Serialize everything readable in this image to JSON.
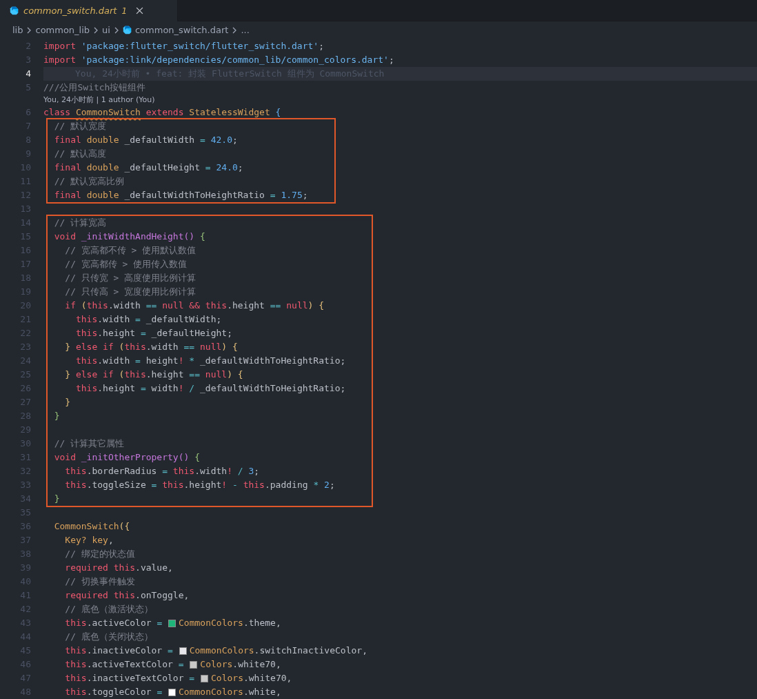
{
  "tabs": [
    {
      "label": "common_switch.dart",
      "problems": "1",
      "selected": true
    }
  ],
  "breadcrumbs": [
    {
      "label": "lib",
      "kind": "folder"
    },
    {
      "label": "common_lib",
      "kind": "folder"
    },
    {
      "label": "ui",
      "kind": "folder"
    },
    {
      "label": "common_switch.dart",
      "kind": "file"
    },
    {
      "label": "...",
      "kind": "more"
    }
  ],
  "blocks": [
    {
      "boxed": false,
      "lines": [
        {
          "number": "2",
          "current": false,
          "tokens": [
            {
              "kind": "kw",
              "text": "import "
            },
            {
              "kind": "str",
              "text": "'package:flutter_switch/flutter_switch.dart'"
            },
            {
              "kind": "plain",
              "text": ";"
            }
          ]
        },
        {
          "number": "3",
          "current": false,
          "tokens": [
            {
              "kind": "kw",
              "text": "import "
            },
            {
              "kind": "str",
              "text": "'package:link/dependencies/common_lib/common_colors.dart'"
            },
            {
              "kind": "plain",
              "text": ";"
            }
          ]
        },
        {
          "number": "4",
          "current": true,
          "blame": "You, 24小时前 • feat: 封装 FlutterSwitch 组件为 CommonSwitch"
        },
        {
          "number": "5",
          "current": false,
          "codelens": "You, 24小时前 | 1 author (You)",
          "tokens": [
            {
              "kind": "com",
              "text": "///公用Switch按钮组件"
            }
          ]
        },
        {
          "number": "6",
          "current": false,
          "tokens": [
            {
              "kind": "kw",
              "text": "class "
            },
            {
              "kind": "type",
              "text": "CommonSwitch",
              "warning": true
            },
            {
              "kind": "kw",
              "text": " extends "
            },
            {
              "kind": "type",
              "text": "StatelessWidget "
            },
            {
              "kind": "brace3",
              "text": "{"
            }
          ]
        }
      ]
    },
    {
      "boxed": true,
      "lines": [
        {
          "number": "7",
          "current": false,
          "tokens": [
            {
              "kind": "com",
              "text": "  // 默认宽度"
            }
          ]
        },
        {
          "number": "8",
          "current": false,
          "tokens": [
            {
              "kind": "kw",
              "text": "  final "
            },
            {
              "kind": "type",
              "text": "double "
            },
            {
              "kind": "plain",
              "text": "_defaultWidth "
            },
            {
              "kind": "op",
              "text": "= "
            },
            {
              "kind": "num",
              "text": "42.0"
            },
            {
              "kind": "plain",
              "text": ";"
            }
          ]
        },
        {
          "number": "9",
          "current": false,
          "tokens": [
            {
              "kind": "com",
              "text": "  // 默认高度"
            }
          ]
        },
        {
          "number": "10",
          "current": false,
          "tokens": [
            {
              "kind": "kw",
              "text": "  final "
            },
            {
              "kind": "type",
              "text": "double "
            },
            {
              "kind": "plain",
              "text": "_defaultHeight "
            },
            {
              "kind": "op",
              "text": "= "
            },
            {
              "kind": "num",
              "text": "24.0"
            },
            {
              "kind": "plain",
              "text": ";"
            }
          ]
        },
        {
          "number": "11",
          "current": false,
          "tokens": [
            {
              "kind": "com",
              "text": "  // 默认宽高比例"
            }
          ]
        },
        {
          "number": "12",
          "current": false,
          "tokens": [
            {
              "kind": "kw",
              "text": "  final "
            },
            {
              "kind": "type",
              "text": "double "
            },
            {
              "kind": "plain",
              "text": "_defaultWidthToHeightRatio "
            },
            {
              "kind": "op",
              "text": "= "
            },
            {
              "kind": "num",
              "text": "1.75"
            },
            {
              "kind": "plain",
              "text": ";"
            }
          ]
        }
      ]
    },
    {
      "boxed": false,
      "lines": [
        {
          "number": "13",
          "current": false
        }
      ]
    },
    {
      "boxed": true,
      "lines": [
        {
          "number": "14",
          "current": false,
          "tokens": [
            {
              "kind": "com",
              "text": "  // 计算宽高"
            }
          ]
        },
        {
          "number": "15",
          "current": false,
          "tokens": [
            {
              "kind": "kw",
              "text": "  void "
            },
            {
              "kind": "fn",
              "text": "_initWidthAndHeight"
            },
            {
              "kind": "brace2",
              "text": "() "
            },
            {
              "kind": "brace4",
              "text": "{"
            }
          ]
        },
        {
          "number": "16",
          "current": false,
          "tokens": [
            {
              "kind": "com",
              "text": "    // 宽高都不传 > 使用默认数值"
            }
          ]
        },
        {
          "number": "17",
          "current": false,
          "tokens": [
            {
              "kind": "com",
              "text": "    // 宽高都传 > 使用传入数值"
            }
          ]
        },
        {
          "number": "18",
          "current": false,
          "tokens": [
            {
              "kind": "com",
              "text": "    // 只传宽 > 高度使用比例计算"
            }
          ]
        },
        {
          "number": "19",
          "current": false,
          "tokens": [
            {
              "kind": "com",
              "text": "    // 只传高 > 宽度使用比例计算"
            }
          ]
        },
        {
          "number": "20",
          "current": false,
          "tokens": [
            {
              "kind": "kw",
              "text": "    if "
            },
            {
              "kind": "brace1",
              "text": "("
            },
            {
              "kind": "kw",
              "text": "this"
            },
            {
              "kind": "plain",
              "text": ".width "
            },
            {
              "kind": "op",
              "text": "== "
            },
            {
              "kind": "kw",
              "text": "null && this"
            },
            {
              "kind": "plain",
              "text": ".height "
            },
            {
              "kind": "op",
              "text": "== "
            },
            {
              "kind": "kw",
              "text": "null"
            },
            {
              "kind": "brace1",
              "text": ") {"
            }
          ]
        },
        {
          "number": "21",
          "current": false,
          "tokens": [
            {
              "kind": "kw",
              "text": "      this"
            },
            {
              "kind": "plain",
              "text": ".width "
            },
            {
              "kind": "op",
              "text": "="
            },
            {
              "kind": "plain",
              "text": " _defaultWidth;"
            }
          ]
        },
        {
          "number": "22",
          "current": false,
          "tokens": [
            {
              "kind": "kw",
              "text": "      this"
            },
            {
              "kind": "plain",
              "text": ".height "
            },
            {
              "kind": "op",
              "text": "="
            },
            {
              "kind": "plain",
              "text": " _defaultHeight;"
            }
          ]
        },
        {
          "number": "23",
          "current": false,
          "tokens": [
            {
              "kind": "brace1",
              "text": "    } "
            },
            {
              "kind": "kw",
              "text": "else if "
            },
            {
              "kind": "brace1",
              "text": "("
            },
            {
              "kind": "kw",
              "text": "this"
            },
            {
              "kind": "plain",
              "text": ".width "
            },
            {
              "kind": "op",
              "text": "== "
            },
            {
              "kind": "kw",
              "text": "null"
            },
            {
              "kind": "brace1",
              "text": ") {"
            }
          ]
        },
        {
          "number": "24",
          "current": false,
          "tokens": [
            {
              "kind": "kw",
              "text": "      this"
            },
            {
              "kind": "plain",
              "text": ".width "
            },
            {
              "kind": "op",
              "text": "="
            },
            {
              "kind": "plain",
              "text": " height"
            },
            {
              "kind": "kw",
              "text": "! "
            },
            {
              "kind": "op",
              "text": "*"
            },
            {
              "kind": "plain",
              "text": " _defaultWidthToHeightRatio;"
            }
          ]
        },
        {
          "number": "25",
          "current": false,
          "tokens": [
            {
              "kind": "brace1",
              "text": "    } "
            },
            {
              "kind": "kw",
              "text": "else if "
            },
            {
              "kind": "brace1",
              "text": "("
            },
            {
              "kind": "kw",
              "text": "this"
            },
            {
              "kind": "plain",
              "text": ".height "
            },
            {
              "kind": "op",
              "text": "== "
            },
            {
              "kind": "kw",
              "text": "null"
            },
            {
              "kind": "brace1",
              "text": ") {"
            }
          ]
        },
        {
          "number": "26",
          "current": false,
          "tokens": [
            {
              "kind": "kw",
              "text": "      this"
            },
            {
              "kind": "plain",
              "text": ".height "
            },
            {
              "kind": "op",
              "text": "="
            },
            {
              "kind": "plain",
              "text": " width"
            },
            {
              "kind": "kw",
              "text": "! "
            },
            {
              "kind": "op",
              "text": "/"
            },
            {
              "kind": "plain",
              "text": " _defaultWidthToHeightRatio;"
            }
          ]
        },
        {
          "number": "27",
          "current": false,
          "tokens": [
            {
              "kind": "brace1",
              "text": "    }"
            }
          ]
        },
        {
          "number": "28",
          "current": false,
          "tokens": [
            {
              "kind": "brace4",
              "text": "  }"
            }
          ]
        },
        {
          "number": "29",
          "current": false
        },
        {
          "number": "30",
          "current": false,
          "tokens": [
            {
              "kind": "com",
              "text": "  // 计算其它属性"
            }
          ]
        },
        {
          "number": "31",
          "current": false,
          "tokens": [
            {
              "kind": "kw",
              "text": "  void "
            },
            {
              "kind": "fn",
              "text": "_initOtherProperty"
            },
            {
              "kind": "brace2",
              "text": "() "
            },
            {
              "kind": "brace4",
              "text": "{"
            }
          ]
        },
        {
          "number": "32",
          "current": false,
          "tokens": [
            {
              "kind": "kw",
              "text": "    this"
            },
            {
              "kind": "plain",
              "text": ".borderRadius "
            },
            {
              "kind": "op",
              "text": "= "
            },
            {
              "kind": "kw",
              "text": "this"
            },
            {
              "kind": "plain",
              "text": ".width"
            },
            {
              "kind": "kw",
              "text": "! "
            },
            {
              "kind": "op",
              "text": "/ "
            },
            {
              "kind": "num",
              "text": "3"
            },
            {
              "kind": "plain",
              "text": ";"
            }
          ]
        },
        {
          "number": "33",
          "current": false,
          "tokens": [
            {
              "kind": "kw",
              "text": "    this"
            },
            {
              "kind": "plain",
              "text": ".toggleSize "
            },
            {
              "kind": "op",
              "text": "= "
            },
            {
              "kind": "kw",
              "text": "this"
            },
            {
              "kind": "plain",
              "text": ".height"
            },
            {
              "kind": "kw",
              "text": "! "
            },
            {
              "kind": "op",
              "text": "- "
            },
            {
              "kind": "kw",
              "text": "this"
            },
            {
              "kind": "plain",
              "text": ".padding "
            },
            {
              "kind": "op",
              "text": "* "
            },
            {
              "kind": "num",
              "text": "2"
            },
            {
              "kind": "plain",
              "text": ";"
            }
          ]
        },
        {
          "number": "34",
          "current": false,
          "tokens": [
            {
              "kind": "brace4",
              "text": "  }"
            }
          ]
        }
      ]
    },
    {
      "boxed": false,
      "lines": [
        {
          "number": "35",
          "current": false
        },
        {
          "number": "36",
          "current": false,
          "tokens": [
            {
              "kind": "type",
              "text": "  CommonSwitch"
            },
            {
              "kind": "brace1",
              "text": "({"
            }
          ]
        },
        {
          "number": "37",
          "current": false,
          "tokens": [
            {
              "kind": "type",
              "text": "    Key? key"
            },
            {
              "kind": "plain",
              "text": ","
            }
          ]
        },
        {
          "number": "38",
          "current": false,
          "tokens": [
            {
              "kind": "com",
              "text": "    // 绑定的状态值"
            }
          ]
        },
        {
          "number": "39",
          "current": false,
          "tokens": [
            {
              "kind": "kw",
              "text": "    required this"
            },
            {
              "kind": "plain",
              "text": ".value,"
            }
          ]
        },
        {
          "number": "40",
          "current": false,
          "tokens": [
            {
              "kind": "com",
              "text": "    // 切换事件触发"
            }
          ]
        },
        {
          "number": "41",
          "current": false,
          "tokens": [
            {
              "kind": "kw",
              "text": "    required this"
            },
            {
              "kind": "plain",
              "text": ".onToggle,"
            }
          ]
        },
        {
          "number": "42",
          "current": false,
          "tokens": [
            {
              "kind": "com",
              "text": "    // 底色（激活状态）"
            }
          ]
        },
        {
          "number": "43",
          "current": false,
          "tokens": [
            {
              "kind": "kw",
              "text": "    this"
            },
            {
              "kind": "plain",
              "text": ".activeColor "
            },
            {
              "kind": "op",
              "text": "= "
            },
            {
              "kind": "swatch",
              "color": "#1fb57a"
            },
            {
              "kind": "type",
              "text": "CommonColors"
            },
            {
              "kind": "plain",
              "text": ".theme,"
            }
          ]
        },
        {
          "number": "44",
          "current": false,
          "tokens": [
            {
              "kind": "com",
              "text": "    // 底色（关闭状态）"
            }
          ]
        },
        {
          "number": "45",
          "current": false,
          "tokens": [
            {
              "kind": "kw",
              "text": "    this"
            },
            {
              "kind": "plain",
              "text": ".inactiveColor "
            },
            {
              "kind": "op",
              "text": "= "
            },
            {
              "kind": "swatch",
              "color": "#e6e6ea"
            },
            {
              "kind": "type",
              "text": "CommonColors"
            },
            {
              "kind": "plain",
              "text": ".switchInactiveColor,"
            }
          ]
        },
        {
          "number": "46",
          "current": false,
          "tokens": [
            {
              "kind": "kw",
              "text": "    this"
            },
            {
              "kind": "plain",
              "text": ".activeTextColor "
            },
            {
              "kind": "op",
              "text": "= "
            },
            {
              "kind": "swatch",
              "color": "#c8c8c8"
            },
            {
              "kind": "type",
              "text": "Colors"
            },
            {
              "kind": "plain",
              "text": ".white70,"
            }
          ]
        },
        {
          "number": "47",
          "current": false,
          "tokens": [
            {
              "kind": "kw",
              "text": "    this"
            },
            {
              "kind": "plain",
              "text": ".inactiveTextColor "
            },
            {
              "kind": "op",
              "text": "= "
            },
            {
              "kind": "swatch",
              "color": "#c8c8c8"
            },
            {
              "kind": "type",
              "text": "Colors"
            },
            {
              "kind": "plain",
              "text": ".white70,"
            }
          ]
        },
        {
          "number": "48",
          "current": false,
          "tokens": [
            {
              "kind": "kw",
              "text": "    this"
            },
            {
              "kind": "plain",
              "text": ".toggleColor "
            },
            {
              "kind": "op",
              "text": "= "
            },
            {
              "kind": "swatch",
              "color": "#ffffff"
            },
            {
              "kind": "type",
              "text": "CommonColors"
            },
            {
              "kind": "plain",
              "text": ".white,"
            }
          ]
        }
      ]
    }
  ]
}
